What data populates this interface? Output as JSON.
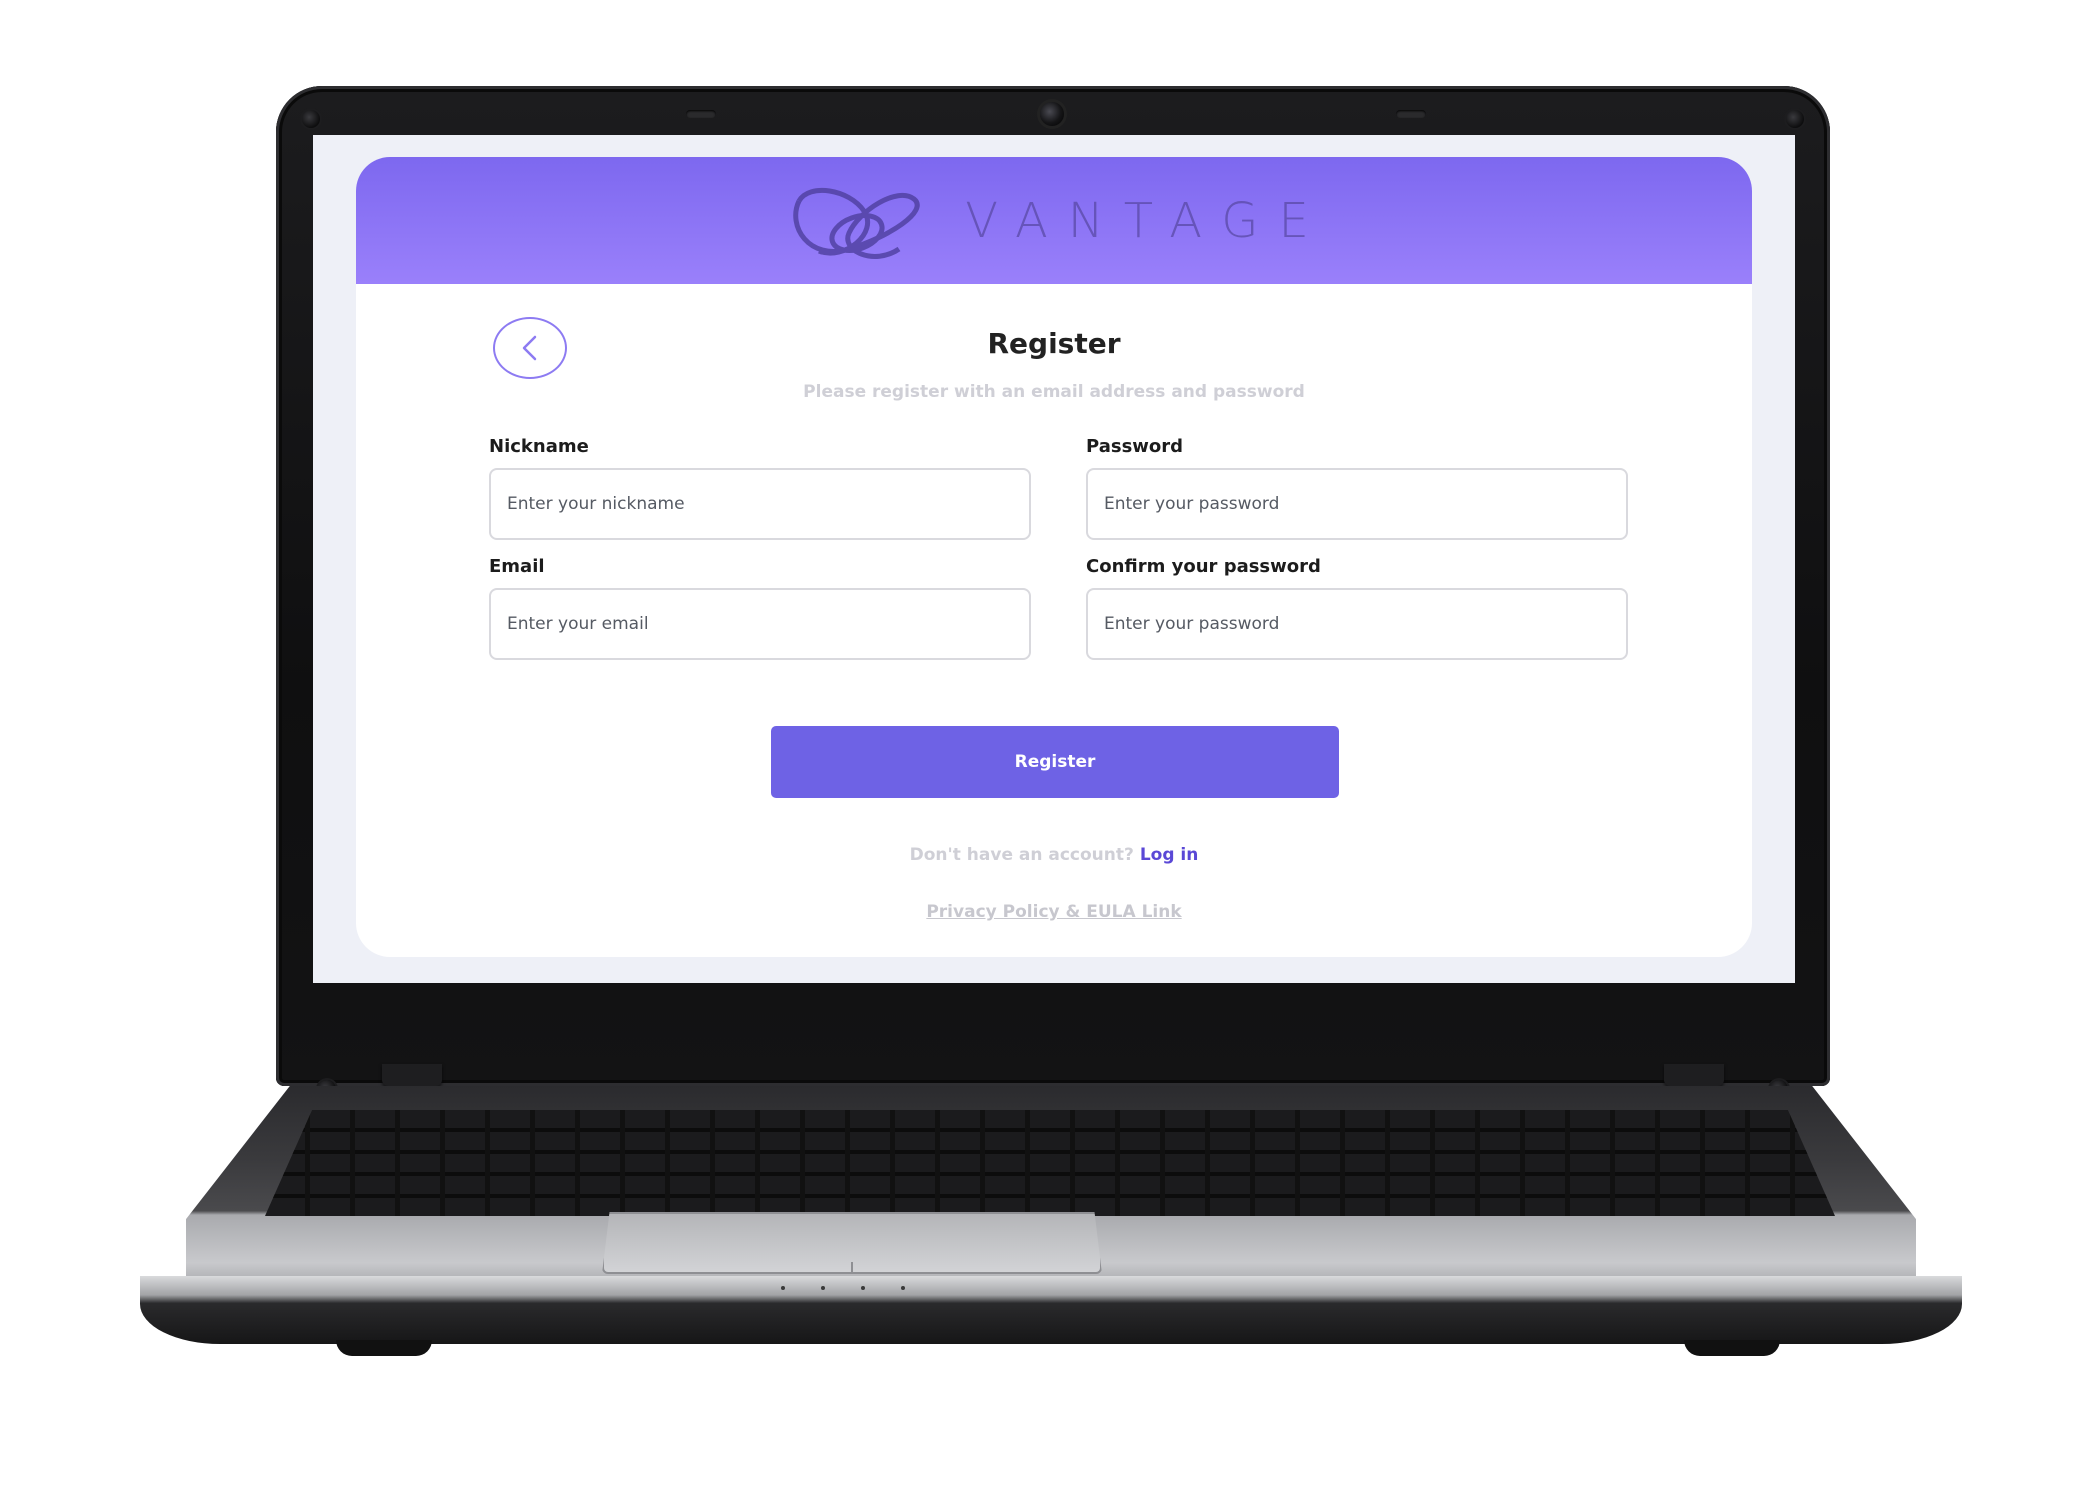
{
  "app": {
    "brand": "VANTAGE"
  },
  "page": {
    "title": "Register",
    "subtitle": "Please register with an email address and password"
  },
  "form": {
    "nickname": {
      "label": "Nickname",
      "placeholder": "Enter your nickname"
    },
    "email": {
      "label": "Email",
      "placeholder": "Enter your email"
    },
    "password": {
      "label": "Password",
      "placeholder": "Enter your password"
    },
    "confirm_password": {
      "label": "Confirm your password",
      "placeholder": "Enter your password"
    },
    "submit_label": "Register"
  },
  "footer": {
    "account_prompt": "Don't have an account?",
    "login_label": "Log in",
    "privacy_label": "Privacy Policy & EULA Link"
  },
  "icons": {
    "back": "chevron-left-icon",
    "logo": "infinity-loop-logo"
  },
  "colors": {
    "header_start": "#7d68ef",
    "header_end": "#9a80fb",
    "accent": "#6e62e5",
    "link": "#5a48d6",
    "muted_text": "#cfcfd6",
    "screen_bg": "#eef0f7"
  }
}
